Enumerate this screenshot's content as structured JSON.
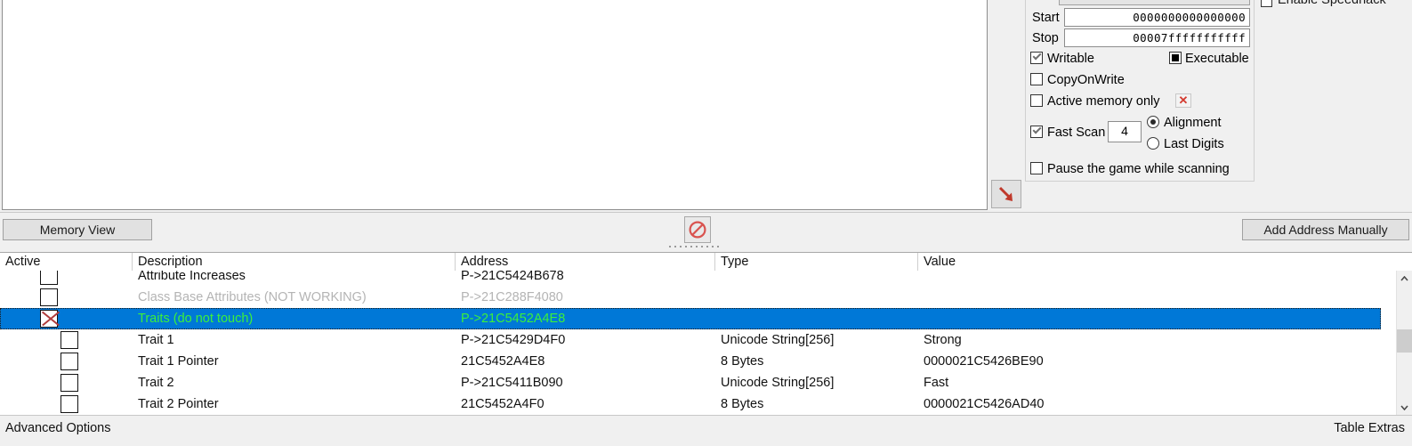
{
  "app": {
    "name": "Cheat Engine"
  },
  "scan_options": {
    "start": {
      "label": "Start",
      "value": "0000000000000000"
    },
    "stop": {
      "label": "Stop",
      "value": "00007fffffffffff"
    },
    "writable": {
      "label": "Writable",
      "checked": true
    },
    "executable": {
      "label": "Executable",
      "state": "grayed"
    },
    "copyonwrite": {
      "label": "CopyOnWrite",
      "checked": false
    },
    "active_memory_only": {
      "label": "Active memory only",
      "checked": false
    },
    "active_memory_clear_icon": "red-x-icon",
    "fast_scan": {
      "label": "Fast Scan",
      "checked": true,
      "value": "4"
    },
    "alignment": {
      "label": "Alignment",
      "selected": true
    },
    "last_digits": {
      "label": "Last Digits",
      "selected": false
    },
    "pause_game": {
      "label": "Pause the game while scanning",
      "checked": false
    }
  },
  "speedhack": {
    "label": "Enable Speedhack",
    "checked": false
  },
  "toolbar": {
    "memory_view_label": "Memory View",
    "add_address_label": "Add Address Manually",
    "cancel_icon": "no-entry-icon",
    "arrow_icon": "red-arrow-down-right-icon"
  },
  "table": {
    "columns": [
      "Active",
      "Description",
      "Address",
      "Type",
      "Value"
    ],
    "rows": [
      {
        "description": "Attribute Increases",
        "address": "P->21C5424B678",
        "type": "",
        "value": "",
        "active": false,
        "dim": false,
        "selected": false,
        "indent": false,
        "clipped": true
      },
      {
        "description": "Class Base Attributes (NOT WORKING)",
        "address": "P->21C288F4080",
        "type": "",
        "value": "",
        "active": false,
        "dim": true,
        "selected": false,
        "indent": false
      },
      {
        "description": "Traits (do not touch)",
        "address": "P->21C5452A4E8",
        "type": "",
        "value": "",
        "active": true,
        "dim": false,
        "selected": true,
        "indent": false
      },
      {
        "description": "Trait 1",
        "address": "P->21C5429D4F0",
        "type": "Unicode String[256]",
        "value": "Strong",
        "active": false,
        "dim": false,
        "selected": false,
        "indent": true
      },
      {
        "description": "Trait 1 Pointer",
        "address": "21C5452A4E8",
        "type": "8 Bytes",
        "value": "0000021C5426BE90",
        "active": false,
        "dim": false,
        "selected": false,
        "indent": true
      },
      {
        "description": "Trait 2",
        "address": "P->21C5411B090",
        "type": "Unicode String[256]",
        "value": "Fast",
        "active": false,
        "dim": false,
        "selected": false,
        "indent": true
      },
      {
        "description": "Trait 2 Pointer",
        "address": "21C5452A4F0",
        "type": "8 Bytes",
        "value": "0000021C5426AD40",
        "active": false,
        "dim": false,
        "selected": false,
        "indent": true
      }
    ],
    "scrollbar": {
      "up_icon": "chevron-up-icon",
      "down_icon": "chevron-down-icon"
    }
  },
  "statusbar": {
    "advanced_options": "Advanced Options",
    "table_extras": "Table Extras"
  },
  "colors": {
    "selection_blue": "#0078d7",
    "selected_text_green": "#3cf03c",
    "disabled_grey": "#b4b4b4",
    "accent_red": "#c0392b"
  }
}
